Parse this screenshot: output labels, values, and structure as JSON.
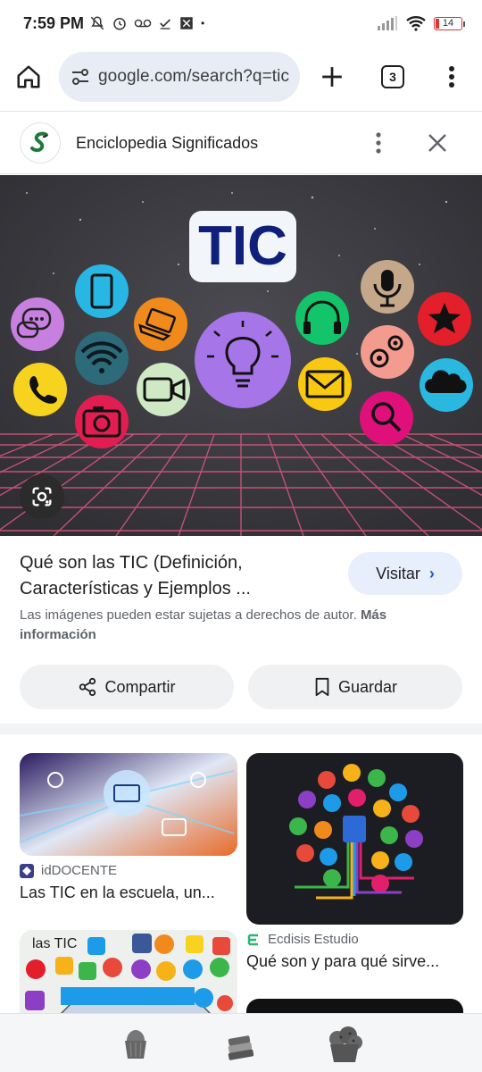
{
  "status_bar": {
    "time": "7:59 PM",
    "battery": "14"
  },
  "toolbar": {
    "url": "google.com/search?q=tic",
    "tab_count": "3",
    "icons": [
      "home-icon",
      "site-settings-icon",
      "plus-icon",
      "tabs-icon",
      "more-vert-icon"
    ]
  },
  "site": {
    "name": "Enciclopedia Significados"
  },
  "hero": {
    "badge_text": "TIC",
    "icons": [
      "chat-icon",
      "phone-icon",
      "smartphone-icon",
      "wifi-icon",
      "camera-icon",
      "laptop-icon",
      "video-icon",
      "lightbulb-icon",
      "headphones-icon",
      "mail-icon",
      "microphone-icon",
      "gears-icon",
      "search-icon",
      "star-icon",
      "cloud-icon"
    ],
    "colors": {
      "background": "#3a3a3e",
      "grid": "#e0567e",
      "badge_text": "#0f1f7a"
    }
  },
  "result": {
    "title_line1": "Qué son las TIC (Definición,",
    "title_line2": "Características y Ejemplos ...",
    "visit_label": "Visitar",
    "copyright_text": "Las imágenes pueden estar sujetas a derechos de autor.",
    "copyright_link": "Más información",
    "share_label": "Compartir",
    "save_label": "Guardar"
  },
  "related": [
    {
      "source": "idDOCENTE",
      "title": "Las TIC en la escuela, un..."
    },
    {
      "source": "Ecdisis Estudio",
      "title": "Qué son y para qué sirve..."
    },
    {
      "badge": "las TIC"
    }
  ],
  "colors": {
    "accent": "#1a56d6",
    "pill_bg": "#e8effc",
    "url_bg": "#e8ecf4"
  }
}
